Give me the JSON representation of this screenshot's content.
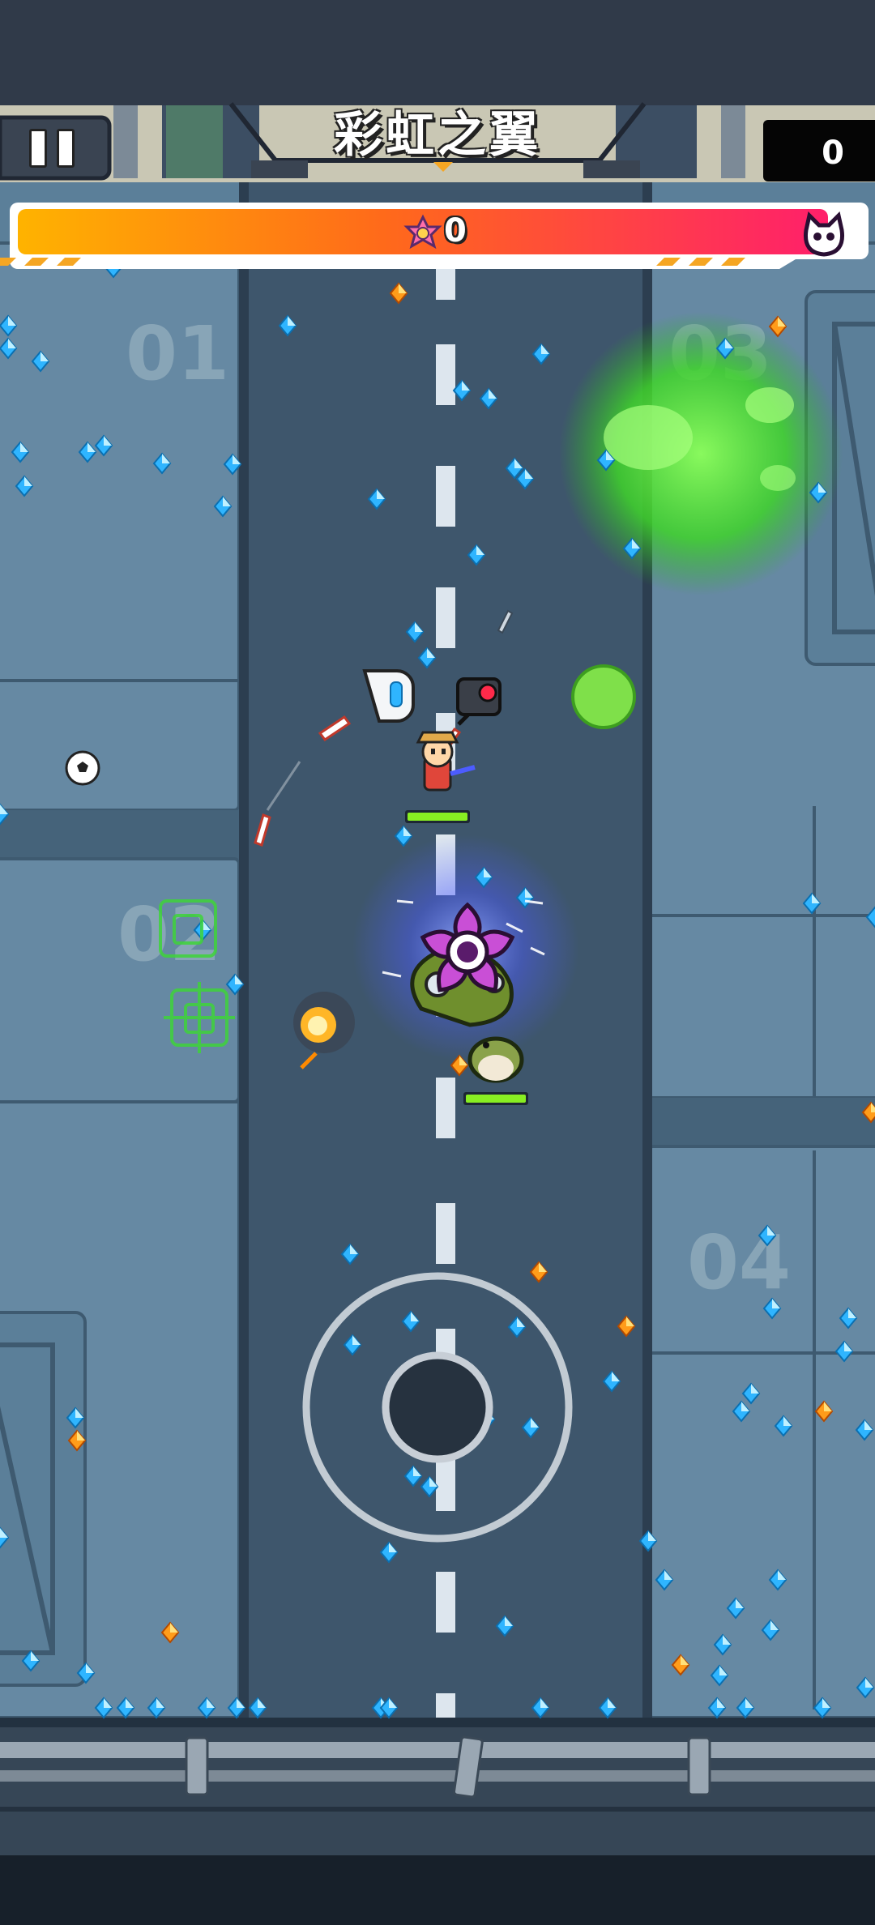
{
  "hud": {
    "level_title": "彩虹之翼",
    "score": "0",
    "boss_progress": "0",
    "pause_icon": "pause-icon",
    "boss_icon": "cat-demon-skull-icon",
    "progress_icon": "gem-burst-icon"
  },
  "map": {
    "zone_labels": [
      "01",
      "02",
      "03",
      "04"
    ]
  },
  "colors": {
    "progress_start": "#ffb300",
    "progress_end": "#ff1f6b",
    "road": "#3e566c",
    "floor": "#597e99",
    "gem_blue": "#2fb5ff",
    "gem_orange": "#ff8a00",
    "acid_green": "#4ee03a"
  },
  "icons": {
    "player": "cowboy-hero-icon",
    "enemy": "purple-flower-monster-icon",
    "joystick": "virtual-joystick-icon"
  }
}
